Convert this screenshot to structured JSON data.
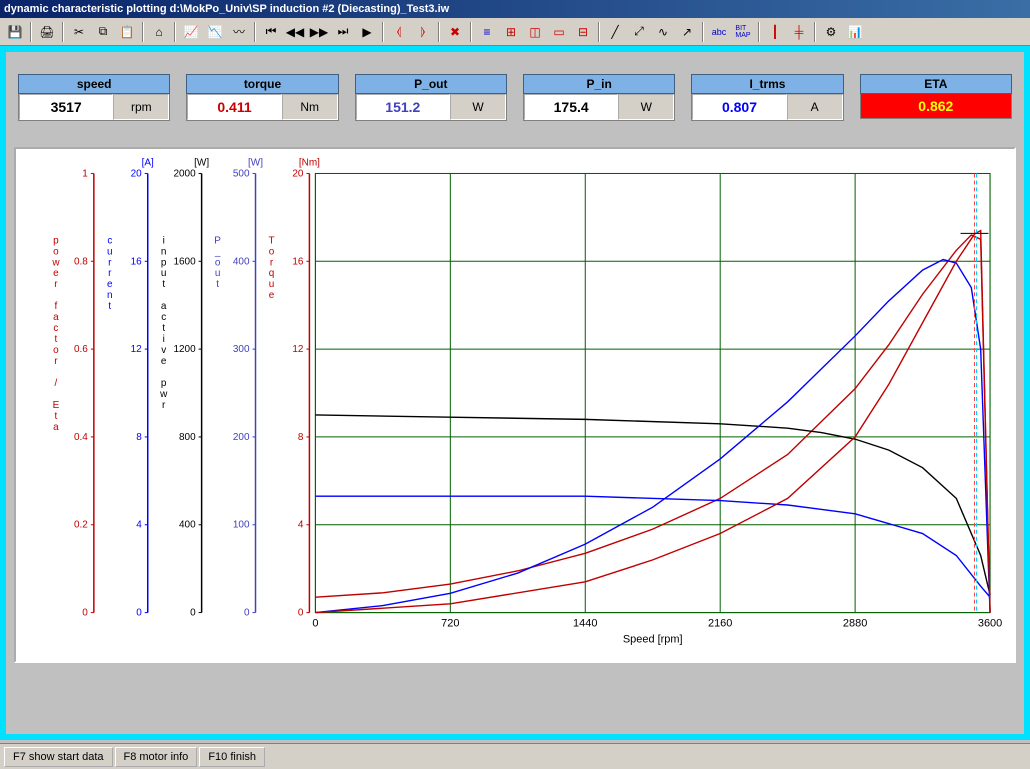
{
  "window": {
    "title": "dynamic characteristic plotting  d:\\MokPo_Univ\\SP induction #2 (Diecasting)_Test3.iw"
  },
  "toolbar": {
    "icons": [
      "save",
      "print",
      "cut",
      "copy",
      "paste",
      "home",
      "chart1",
      "chart2",
      "chart3",
      "first",
      "prev",
      "next",
      "last",
      "play",
      "left",
      "right",
      "stop",
      "bars",
      "grid1",
      "grid2",
      "grid3",
      "grid4",
      "line1",
      "line2",
      "line3",
      "line4",
      "abc",
      "bitmap",
      "marker1",
      "marker2",
      "tool1",
      "tool2"
    ]
  },
  "readouts": {
    "speed": {
      "label": "speed",
      "value": "3517",
      "unit": "rpm",
      "color": "#000"
    },
    "torque": {
      "label": "torque",
      "value": "0.411",
      "unit": "Nm",
      "color": "#c00"
    },
    "p_out": {
      "label": "P_out",
      "value": "151.2",
      "unit": "W",
      "color": "#4040c0"
    },
    "p_in": {
      "label": "P_in",
      "value": "175.4",
      "unit": "W",
      "color": "#000"
    },
    "i_trms": {
      "label": "I_trms",
      "value": "0.807",
      "unit": "A",
      "color": "#0000ff"
    },
    "eta": {
      "label": "ETA",
      "value": "0.862"
    }
  },
  "statusbar": {
    "b1": "F7 show start data",
    "b2": "F8 motor info",
    "b3": "F10 finish"
  },
  "chart_data": {
    "type": "line",
    "xlabel": "Speed [rpm]",
    "xlim": [
      0,
      3600
    ],
    "xticks": [
      0,
      720,
      1440,
      2160,
      2880,
      3600
    ],
    "marker_x": 3517,
    "y_axes": [
      {
        "name": "power factor / Eta",
        "unit": "",
        "color": "#c00000",
        "range": [
          0,
          1
        ],
        "ticks": [
          0,
          0.2,
          0.4,
          0.6,
          0.8,
          1
        ]
      },
      {
        "name": "current",
        "unit": "[A]",
        "color": "#0000ff",
        "range": [
          0,
          20
        ],
        "ticks": [
          0,
          4,
          8,
          12,
          16,
          20
        ]
      },
      {
        "name": "input active pwr",
        "unit": "[W]",
        "color": "#000000",
        "range": [
          0,
          2000
        ],
        "ticks": [
          0,
          400,
          800,
          1200,
          1600,
          2000
        ]
      },
      {
        "name": "P_out",
        "unit": "[W]",
        "color": "#4040c0",
        "range": [
          0,
          500
        ],
        "ticks": [
          0,
          100,
          200,
          300,
          400,
          500
        ]
      },
      {
        "name": "Torque",
        "unit": "[Nm]",
        "color": "#c00000",
        "range": [
          0,
          20
        ],
        "ticks": [
          0,
          4,
          8,
          12,
          16,
          20
        ]
      }
    ],
    "series": [
      {
        "name": "Torque",
        "axis": 4,
        "color": "#c00000",
        "x": [
          0,
          360,
          720,
          1080,
          1440,
          1800,
          2160,
          2520,
          2880,
          3060,
          3240,
          3420,
          3500,
          3550,
          3600
        ],
        "y": [
          0.7,
          0.9,
          1.3,
          1.9,
          2.7,
          3.8,
          5.2,
          7.2,
          10.2,
          12.2,
          14.5,
          16.5,
          17.2,
          17.0,
          0
        ]
      },
      {
        "name": "current",
        "axis": 1,
        "color": "#0000ff",
        "x": [
          0,
          720,
          1440,
          2160,
          2520,
          2880,
          3240,
          3420,
          3550,
          3600
        ],
        "y": [
          5.3,
          5.3,
          5.3,
          5.1,
          4.9,
          4.5,
          3.6,
          2.6,
          1.2,
          0.7
        ]
      },
      {
        "name": "input active pwr",
        "axis": 2,
        "color": "#000000",
        "x": [
          0,
          720,
          1440,
          2160,
          2520,
          2700,
          2880,
          3060,
          3240,
          3420,
          3550,
          3600
        ],
        "y": [
          900,
          890,
          880,
          860,
          840,
          820,
          790,
          740,
          660,
          520,
          260,
          80
        ]
      },
      {
        "name": "P_out",
        "axis": 3,
        "color": "#0000ff",
        "x": [
          0,
          360,
          720,
          1080,
          1440,
          1800,
          2160,
          2520,
          2880,
          3060,
          3240,
          3350,
          3420,
          3500,
          3550,
          3600
        ],
        "y": [
          0,
          8,
          22,
          45,
          78,
          120,
          175,
          240,
          315,
          355,
          390,
          402,
          398,
          370,
          300,
          0
        ]
      },
      {
        "name": "Eta",
        "axis": 0,
        "color": "#c00000",
        "x": [
          0,
          720,
          1440,
          1800,
          2160,
          2520,
          2880,
          3060,
          3240,
          3420,
          3517,
          3550,
          3600
        ],
        "y": [
          0,
          0.02,
          0.07,
          0.12,
          0.18,
          0.26,
          0.4,
          0.52,
          0.66,
          0.8,
          0.862,
          0.87,
          0
        ]
      }
    ]
  }
}
